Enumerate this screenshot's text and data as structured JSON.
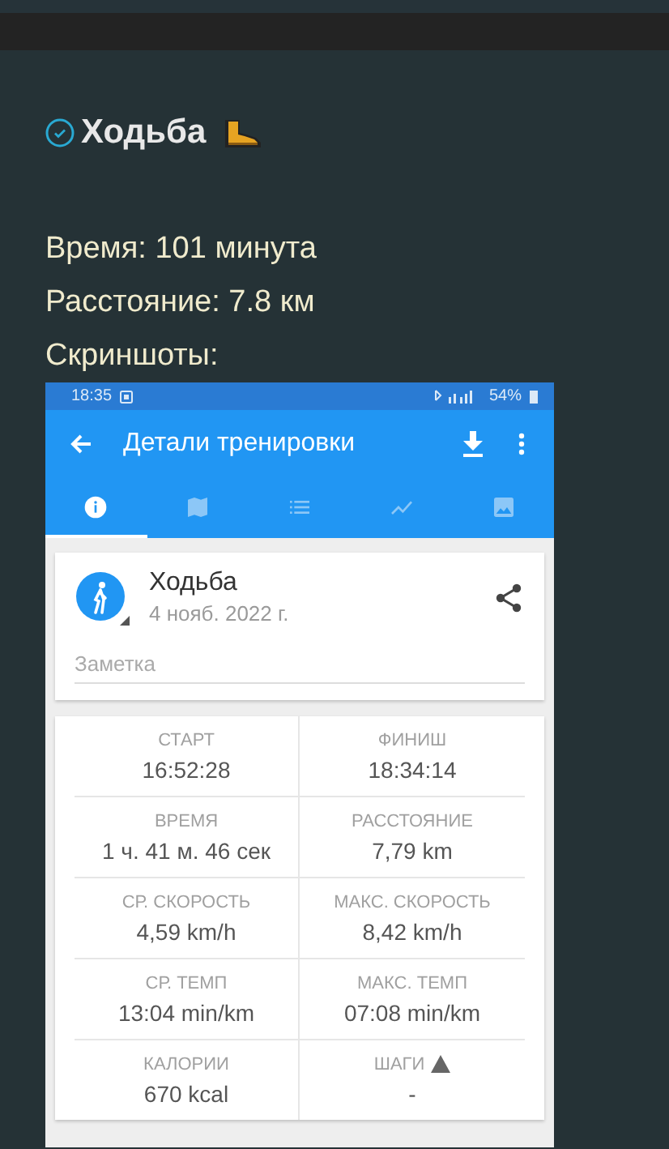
{
  "task": {
    "checked": true,
    "title": "Ходьба"
  },
  "lines": [
    "Время: 101 минута",
    "Расстояние: 7.8 км",
    "Скриншоты:"
  ],
  "screenshot": {
    "status_bar": {
      "time": "18:35",
      "battery": "54%"
    },
    "app_bar": {
      "title": "Детали тренировки"
    },
    "tabs": [
      {
        "selected": true
      },
      {
        "selected": false
      },
      {
        "selected": false
      },
      {
        "selected": false
      },
      {
        "selected": false
      }
    ],
    "activity": {
      "name": "Ходьба",
      "date": "4 нояб. 2022 г.",
      "note_placeholder": "Заметка"
    },
    "stats": [
      {
        "label": "СТАРТ",
        "value": "16:52:28",
        "warning": false
      },
      {
        "label": "ФИНИШ",
        "value": "18:34:14",
        "warning": false
      },
      {
        "label": "ВРЕМЯ",
        "value": "1 ч. 41 м. 46 сек",
        "warning": false
      },
      {
        "label": "РАССТОЯНИЕ",
        "value": "7,79 km",
        "warning": false
      },
      {
        "label": "СР. СКОРОСТЬ",
        "value": "4,59 km/h",
        "warning": false
      },
      {
        "label": "МАКС. СКОРОСТЬ",
        "value": "8,42 km/h",
        "warning": false
      },
      {
        "label": "СР. ТЕМП",
        "value": "13:04 min/km",
        "warning": false
      },
      {
        "label": "МАКС. ТЕМП",
        "value": "07:08 min/km",
        "warning": false
      },
      {
        "label": "КАЛОРИИ",
        "value": "670 kcal",
        "warning": false
      },
      {
        "label": "ШАГИ",
        "value": "-",
        "warning": true
      }
    ]
  }
}
